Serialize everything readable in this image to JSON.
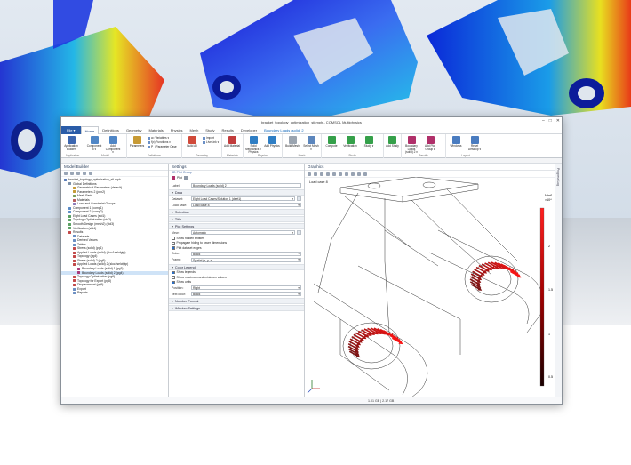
{
  "window": {
    "title": "bracket_topology_optimization_stl.mph - COMSOL Multiphysics",
    "controls": [
      "–",
      "□",
      "✕"
    ]
  },
  "ribbon_tabs": [
    "File ▾",
    "Home",
    "Definitions",
    "Geometry",
    "Materials",
    "Physics",
    "Mesh",
    "Study",
    "Results",
    "Developer",
    "Boundary Loads (solid) 2"
  ],
  "ribbon": {
    "groups": {
      "application": "Application",
      "model": "Model",
      "definitions": "Definitions",
      "geometry": "Geometry",
      "materials": "Materials",
      "physics": "Physics",
      "mesh": "Mesh",
      "study": "Study",
      "results": "Results",
      "layout": "Layout"
    },
    "buttons": {
      "app_builder": "Application Builder",
      "component": "Component 5 ▾",
      "add_component": "Add Component ▾",
      "parameters": "Parameters",
      "variables": "a= Variables ▾",
      "functions": "f(x) Functions ▾",
      "param_case": "P_i Parameter Case",
      "build_all": "Build All",
      "import": "Import",
      "livelink": "LiveLink ▾",
      "add_material": "Add Material",
      "solid_mech": "Solid Mechanics ▾ Physics",
      "add_physics": "Add Physics",
      "build_mesh": "Build Mesh",
      "select_mesh": "Select Mesh ▾",
      "compute": "Compute",
      "verification": "Verification",
      "study_btn": "Study ▾",
      "add_study": "Add Study",
      "boundary_loads": "Boundary Loads (solid) 2 ▾",
      "add_plot_group": "Add Plot Group ▾",
      "windows": "Windows",
      "reset_desktop": "Reset Desktop ▾"
    }
  },
  "model_builder": {
    "title": "Model Builder",
    "tree": [
      {
        "label": "bracket_topology_optimization_stl.mph",
        "depth": 0,
        "color": "#5b7db8"
      },
      {
        "label": "Global Definitions",
        "depth": 1,
        "color": "#7b8fa8"
      },
      {
        "label": "Geometrical Parameters (default)",
        "depth": 2,
        "color": "#c69b37"
      },
      {
        "label": "Parameters 2 (pun2)",
        "depth": 2,
        "color": "#c69b37"
      },
      {
        "label": "Mesh Parts",
        "depth": 2,
        "color": "#7a9c55"
      },
      {
        "label": "Materials",
        "depth": 2,
        "color": "#b85c5c"
      },
      {
        "label": "Load and Constraint Groups",
        "depth": 2,
        "color": "#8a7ab8"
      },
      {
        "label": "Component 1 (comp1)",
        "depth": 1,
        "color": "#5b8bc6"
      },
      {
        "label": "Component 2 (comp2)",
        "depth": 1,
        "color": "#5b8bc6"
      },
      {
        "label": "Eight Load Cases (std1)",
        "depth": 1,
        "color": "#5aa063"
      },
      {
        "label": "Topology Optimization (std2)",
        "depth": 1,
        "color": "#5aa063"
      },
      {
        "label": "Smooth Design (mesh2) (std3)",
        "depth": 1,
        "color": "#5aa063"
      },
      {
        "label": "Verification (std4)",
        "depth": 1,
        "color": "#5aa063"
      },
      {
        "label": "Results",
        "depth": 1,
        "color": "#c24848"
      },
      {
        "label": "Datasets",
        "depth": 2,
        "color": "#6b8ec2"
      },
      {
        "label": "Derived Values",
        "depth": 2,
        "color": "#6b8ec2"
      },
      {
        "label": "Tables",
        "depth": 2,
        "color": "#6b8ec2"
      },
      {
        "label": "Stress (solid) (pg1)",
        "depth": 2,
        "color": "#c24848"
      },
      {
        "label": "Applied Loads (solid) (sloc1selcfgtp)",
        "depth": 2,
        "color": "#c24848"
      },
      {
        "label": "Topology (pg4)",
        "depth": 2,
        "color": "#c24848"
      },
      {
        "label": "Stress (solid) 2 (pg5)",
        "depth": 2,
        "color": "#c24848"
      },
      {
        "label": "Applied Loads (solid) 2 (sloc2selcfgtp)",
        "depth": 2,
        "color": "#c24848"
      },
      {
        "label": "Boundary Loads (solid) 1 (pg3)",
        "depth": 3,
        "color": "#a83a7a"
      },
      {
        "label": "Boundary Loads (solid) 2 (pg4)",
        "depth": 3,
        "color": "#a83a7a",
        "selected": true
      },
      {
        "label": "Topology Optimization (pg6)",
        "depth": 2,
        "color": "#c24848"
      },
      {
        "label": "Topology for Export (pg8)",
        "depth": 2,
        "color": "#c24848"
      },
      {
        "label": "Displacement (pg9)",
        "depth": 2,
        "color": "#c24848"
      },
      {
        "label": "Export",
        "depth": 2,
        "color": "#6b8ec2"
      },
      {
        "label": "Reports",
        "depth": 2,
        "color": "#6b8ec2"
      }
    ]
  },
  "settings": {
    "title": "Settings",
    "subtitle": "3D Plot Group",
    "plot_label": "Plot",
    "label_field": {
      "label": "Label:",
      "value": "Boundary Loads (solid) 2"
    },
    "section_data": "Data",
    "dataset": {
      "label": "Dataset:",
      "value": "Eight Load Cases/Solution 1 (dset1)"
    },
    "load_case": {
      "label": "Load case:",
      "value": "Load case 8"
    },
    "section_selection": "Selection",
    "section_title": "Title",
    "section_plot_settings": "Plot Settings",
    "view": {
      "label": "View:",
      "value": "Automatic"
    },
    "checks_plot": [
      {
        "label": "Show hidden entities",
        "on": false
      },
      {
        "label": "Propagate hiding to lower dimensions",
        "on": false
      },
      {
        "label": "Plot dataset edges",
        "on": true
      }
    ],
    "color": {
      "label": "Color:",
      "value": "Black"
    },
    "frame": {
      "label": "Frame:",
      "value": "Spatial (x, y, z)"
    },
    "section_color_legend": "Color Legend",
    "checks_legend": [
      {
        "label": "Show legends",
        "on": true
      },
      {
        "label": "Show maximum and minimum values",
        "on": false
      },
      {
        "label": "Show units",
        "on": true
      }
    ],
    "position": {
      "label": "Position:",
      "value": "Right"
    },
    "text_color": {
      "label": "Text color:",
      "value": "Black"
    },
    "section_number_format": "Number Format",
    "section_window_settings": "Window Settings"
  },
  "graphics": {
    "title": "Graphics",
    "load_case_label": "Load case 8",
    "legend_unit": "N/m²",
    "legend_exp": "×10⁴",
    "legend_ticks": [
      "2",
      "1.5",
      "1",
      "0.5"
    ]
  },
  "side_strip": {
    "label": "Progress  Log"
  },
  "status": {
    "memory": "1.01 GB | 2.17 GB"
  },
  "colors": {
    "accent": "#2a5ca8",
    "legend_top": "#ff2020",
    "legend_bottom": "#1a0000"
  }
}
